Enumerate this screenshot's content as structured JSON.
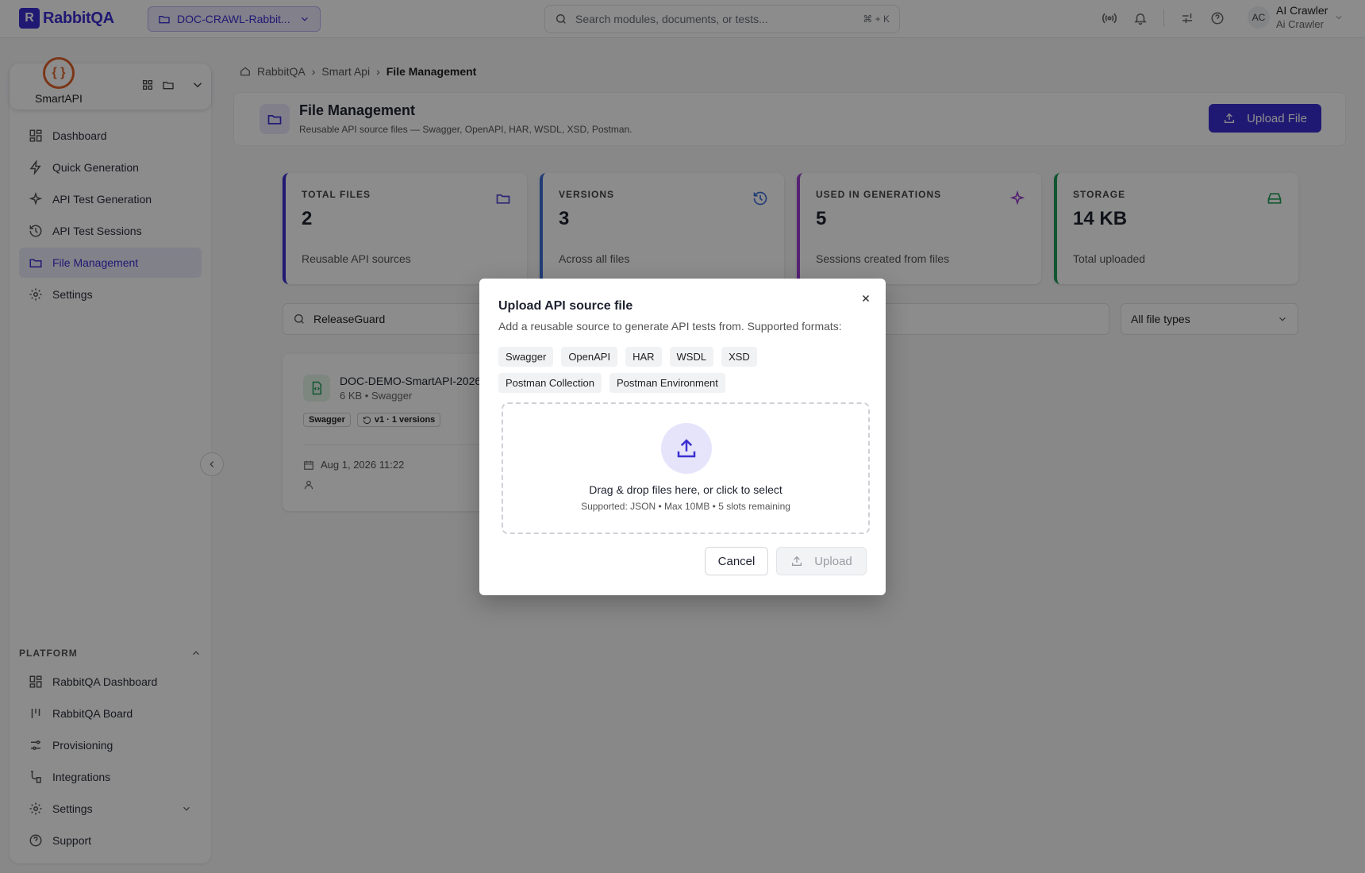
{
  "app": {
    "logo_mark": "R",
    "name": "RabbitQA"
  },
  "project_select": {
    "label": "DOC-CRAWL-Rabbit..."
  },
  "search": {
    "placeholder": "Search modules, documents, or tests...",
    "shortcut": "⌘ + K"
  },
  "user": {
    "initials": "AC",
    "name": "AI Crawler",
    "subtitle": "Ai Crawler"
  },
  "module": {
    "logo": "{ }",
    "name": "SmartAPI"
  },
  "sidebar": {
    "items": [
      {
        "label": "Dashboard",
        "icon": "dashboard-icon"
      },
      {
        "label": "Quick Generation",
        "icon": "bolt-icon"
      },
      {
        "label": "API Test Generation",
        "icon": "sparkle-icon"
      },
      {
        "label": "API Test Sessions",
        "icon": "history-icon"
      },
      {
        "label": "File Management",
        "icon": "folder-icon",
        "active": true
      },
      {
        "label": "Settings",
        "icon": "gear-icon"
      }
    ],
    "platform_header": "PLATFORM",
    "platform_items": [
      {
        "label": "RabbitQA Dashboard",
        "icon": "dashboard-icon"
      },
      {
        "label": "RabbitQA Board",
        "icon": "board-icon"
      },
      {
        "label": "Provisioning",
        "icon": "sliders-icon"
      },
      {
        "label": "Integrations",
        "icon": "integrations-icon"
      },
      {
        "label": "Settings",
        "icon": "gear-icon"
      },
      {
        "label": "Support",
        "icon": "help-icon"
      }
    ]
  },
  "breadcrumb": [
    "RabbitQA",
    "Smart Api",
    "File Management"
  ],
  "page": {
    "title": "File Management",
    "subtitle": "Reusable API source files — Swagger, OpenAPI, HAR, WSDL, XSD, Postman.",
    "upload_button": "Upload File"
  },
  "stats": [
    {
      "label": "TOTAL FILES",
      "value": "2",
      "note": "Reusable API sources",
      "color": "#3b2fd1",
      "icon": "folder-icon"
    },
    {
      "label": "VERSIONS",
      "value": "3",
      "note": "Across all files",
      "color": "#3f6fd8",
      "icon": "history-icon"
    },
    {
      "label": "USED IN GENERATIONS",
      "value": "5",
      "note": "Sessions created from files",
      "color": "#9b3fd1",
      "icon": "sparkle-icon"
    },
    {
      "label": "STORAGE",
      "value": "14 KB",
      "note": "Total uploaded",
      "color": "#1f9d5a",
      "icon": "storage-icon"
    }
  ],
  "filter": {
    "search_value": "ReleaseGuard",
    "type_select": "All file types"
  },
  "file_card": {
    "name": "DOC-DEMO-SmartAPI-2026",
    "meta": "6 KB • Swagger",
    "tags": [
      "Swagger",
      "v1 · 1 versions"
    ],
    "date": "Aug 1, 2026 11:22"
  },
  "modal": {
    "title": "Upload API source file",
    "description": "Add a reusable source to generate API tests from. Supported formats:",
    "formats": [
      "Swagger",
      "OpenAPI",
      "HAR",
      "WSDL",
      "XSD",
      "Postman Collection",
      "Postman Environment"
    ],
    "dropzone_text": "Drag & drop files here, or click to select",
    "dropzone_sub": "Supported: JSON • Max 10MB • 5 slots remaining",
    "cancel": "Cancel",
    "upload": "Upload"
  }
}
